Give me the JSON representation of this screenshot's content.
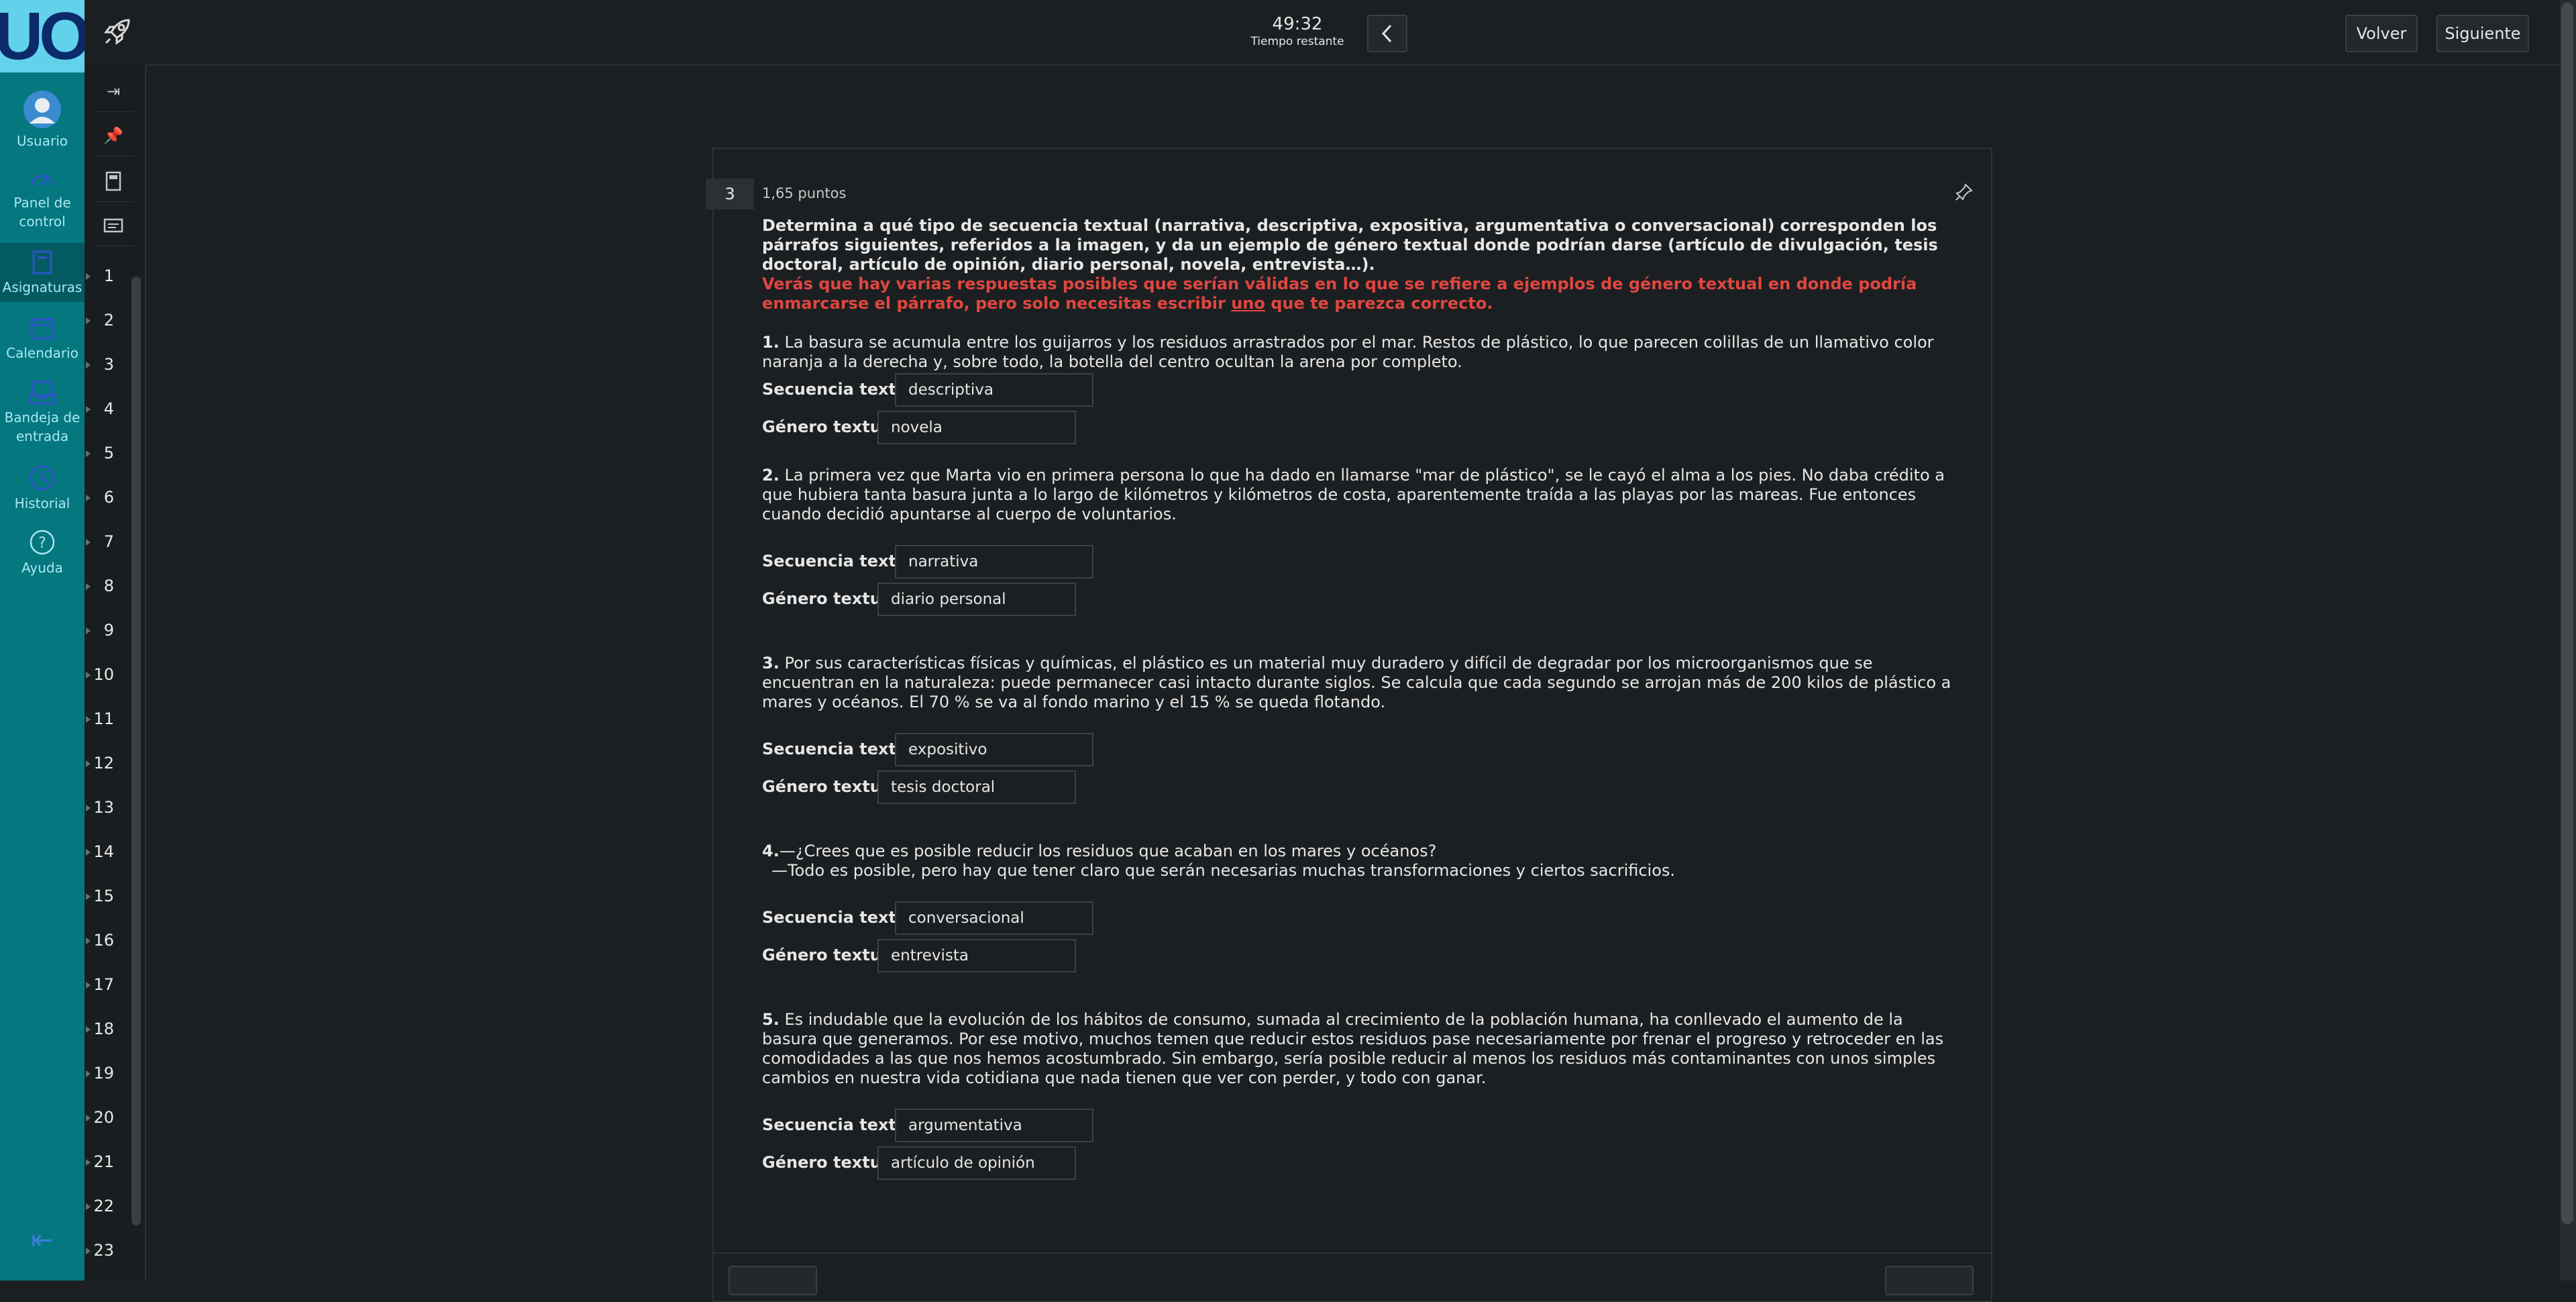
{
  "app": {
    "logo_text": "UOC"
  },
  "nav": {
    "items": [
      {
        "label": "Usuario",
        "icon": "user-avatar-icon"
      },
      {
        "label": "Panel de control",
        "icon": "dashboard-gauge-icon"
      },
      {
        "label": "Asignaturas",
        "icon": "courses-icon",
        "active": true
      },
      {
        "label": "Calendario",
        "icon": "calendar-icon"
      },
      {
        "label": "Bandeja de entrada",
        "icon": "inbox-icon"
      },
      {
        "label": "Historial",
        "icon": "history-clock-icon"
      },
      {
        "label": "Ayuda",
        "icon": "help-icon"
      }
    ]
  },
  "topbar": {
    "timer_value": "49:32",
    "timer_label": "Tiempo restante",
    "back_label": "Volver",
    "next_label": "Siguiente"
  },
  "question_index": [
    "1",
    "2",
    "3",
    "4",
    "5",
    "6",
    "7",
    "8",
    "9",
    "10",
    "11",
    "12",
    "13",
    "14",
    "15",
    "16",
    "17",
    "18",
    "19",
    "20",
    "21",
    "22",
    "23"
  ],
  "question": {
    "number": "3",
    "points": "1,65 puntos",
    "instruction": "Determina a qué tipo de secuencia textual (narrativa, descriptiva, expositiva, argumentativa o conversacional) corresponden los párrafos siguientes, referidos a la imagen, y da un ejemplo de género textual donde podrían darse (artículo de divulgación, tesis doctoral, artículo de opinión, diario personal, novela, entrevista…).",
    "note_part1": "Verás que hay varias respuestas posibles que serían válidas en lo que se refiere a ejemplos de género textual en donde podría enmarcarse el párrafo, pero solo necesitas escribir ",
    "note_underlined": "uno",
    "note_part2": " que te parezca correcto.",
    "seq_label": "Secuencia textual:",
    "gen_label": "Género textual:",
    "items": [
      {
        "num": "1.",
        "text": " La basura se acumula entre los guijarros y los residuos arrastrados por el mar. Restos de plástico, lo que parecen colillas de un llamativo color naranja a la derecha y, sobre todo, la botella del centro ocultan la arena por completo.",
        "seq": "descriptiva",
        "gen": "novela"
      },
      {
        "num": "2.",
        "text": " La primera vez que Marta vio en primera persona lo que ha dado en llamarse \"mar de plástico\", se le cayó el alma a los pies. No daba crédito a que hubiera tanta basura junta a lo largo de kilómetros y kilómetros de costa, aparentemente traída a las playas por las mareas. Fue entonces cuando decidió apuntarse al cuerpo de voluntarios.",
        "seq": "narrativa",
        "gen": "diario personal"
      },
      {
        "num": "3.",
        "text": " Por sus características físicas y químicas, el plástico es un material muy duradero y difícil de degradar por los microorganismos que se encuentran en la naturaleza: puede permanecer casi intacto durante siglos. Se calcula que cada segundo se arrojan más de 200 kilos de plástico a mares y océanos. El 70 % se va al fondo marino y el 15 % se queda flotando.",
        "seq": "expositivo",
        "gen": "tesis doctoral"
      },
      {
        "num": "4.",
        "text": "—¿Crees que es posible reducir los residuos que acaban en los mares y océanos?",
        "text2": "—Todo es posible, pero hay que tener claro que serán necesarias muchas transformaciones y ciertos sacrificios.",
        "seq": "conversacional",
        "gen": "entrevista"
      },
      {
        "num": "5.",
        "text": " Es indudable que la evolución de los hábitos de consumo, sumada al crecimiento de la población humana, ha conllevado el aumento de la basura que generamos. Por ese motivo, muchos temen que reducir estos residuos pase necesariamente por frenar el progreso y retroceder en las comodidades a las que nos hemos acostumbrado. Sin embargo, sería posible reducir al menos los residuos más contaminantes con unos simples cambios en nuestra vida cotidiana que nada tienen que ver con perder, y todo con ganar.",
        "seq": "argumentativa",
        "gen": "artículo de opinión"
      }
    ]
  }
}
